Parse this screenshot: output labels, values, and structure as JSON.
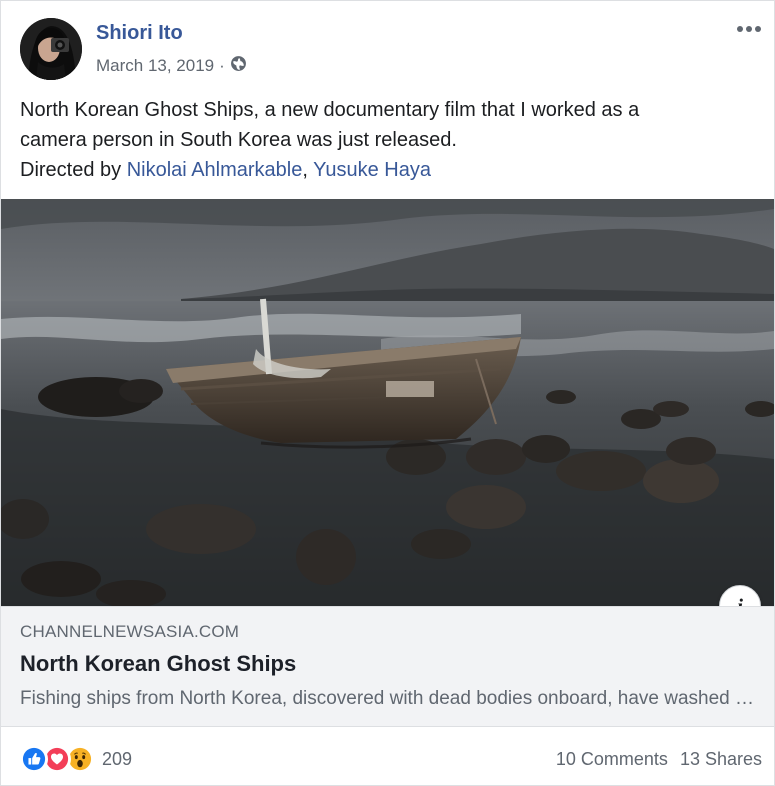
{
  "post": {
    "author": "Shiori Ito",
    "date": "March 13, 2019",
    "separator": "·",
    "privacy_icon": "globe-icon",
    "more_icon": "more-options-icon",
    "text_line1": "North Korean Ghost Ships, a new documentary film that I worked as a",
    "text_line2": "camera person in South Korea was just released.",
    "directed_prefix": "Directed by ",
    "director1": "Nikolai Ahlmarkable",
    "director_sep": ", ",
    "director2": "Yusuke Haya"
  },
  "link_preview": {
    "domain": "CHANNELNEWSASIA.COM",
    "title": "North Korean Ghost Ships",
    "description": "Fishing ships from North Korea, discovered with dead bodies onboard, have washed up on the shores of Japan",
    "info_glyph": "i"
  },
  "footer": {
    "reactions": [
      "like-icon",
      "love-icon",
      "wow-icon"
    ],
    "reaction_count": "209",
    "comments": "10 Comments",
    "shares": "13 Shares"
  },
  "colors": {
    "link": "#385898",
    "muted": "#606770",
    "like": "#1877f2",
    "love": "#f33e58",
    "wow": "#f7b125",
    "preview_bg": "#f2f3f5"
  }
}
